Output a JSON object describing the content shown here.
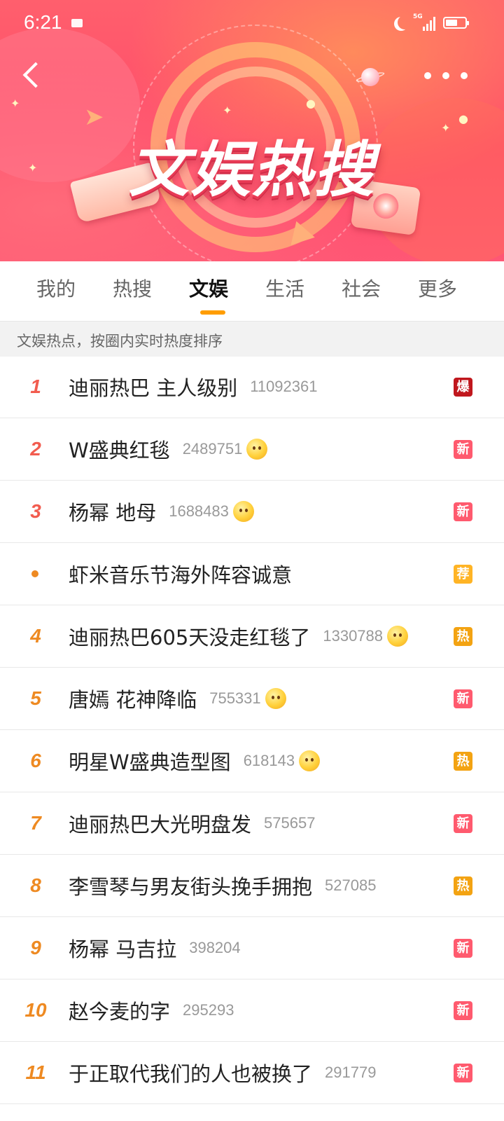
{
  "status_bar": {
    "time": "6:21",
    "network": "5G"
  },
  "header": {
    "title": "文娱热搜"
  },
  "tabs": [
    "我的",
    "热搜",
    "文娱",
    "生活",
    "社会",
    "更多"
  ],
  "active_tab": "文娱",
  "subtitle": "文娱热点，按圈内实时热度排序",
  "list": [
    {
      "rank": "1",
      "title": "迪丽热巴 主人级别",
      "count": "11092361",
      "emoji": "",
      "badge": "爆",
      "badge_color": "#c0171d"
    },
    {
      "rank": "2",
      "title": "W盛典红毯",
      "count": "2489751",
      "emoji": "party-emoji-icon",
      "badge": "新",
      "badge_color": "#ff5a6e"
    },
    {
      "rank": "3",
      "title": "杨幂 地母",
      "count": "1688483",
      "emoji": "crying-emoji-icon",
      "badge": "新",
      "badge_color": "#ff5a6e"
    },
    {
      "rank": "",
      "title": "虾米音乐节海外阵容诚意",
      "count": "",
      "emoji": "",
      "badge": "荐",
      "badge_color": "#ffb425"
    },
    {
      "rank": "4",
      "title": "迪丽热巴605天没走红毯了",
      "count": "1330788",
      "emoji": "hungry-emoji-icon",
      "badge": "热",
      "badge_color": "#f3a312"
    },
    {
      "rank": "5",
      "title": "唐嫣 花神降临",
      "count": "755331",
      "emoji": "love-emoji-icon",
      "badge": "新",
      "badge_color": "#ff5a6e"
    },
    {
      "rank": "6",
      "title": "明星W盛典造型图",
      "count": "618143",
      "emoji": "love-emoji-icon",
      "badge": "热",
      "badge_color": "#f3a312"
    },
    {
      "rank": "7",
      "title": "迪丽热巴大光明盘发",
      "count": "575657",
      "emoji": "",
      "badge": "新",
      "badge_color": "#ff5a6e"
    },
    {
      "rank": "8",
      "title": "李雪琴与男友街头挽手拥抱",
      "count": "527085",
      "emoji": "",
      "badge": "热",
      "badge_color": "#f3a312"
    },
    {
      "rank": "9",
      "title": "杨幂 马吉拉",
      "count": "398204",
      "emoji": "",
      "badge": "新",
      "badge_color": "#ff5a6e"
    },
    {
      "rank": "10",
      "title": "赵今麦的字",
      "count": "295293",
      "emoji": "",
      "badge": "新",
      "badge_color": "#ff5a6e"
    },
    {
      "rank": "11",
      "title": "于正取代我们的人也被换了",
      "count": "291779",
      "emoji": "",
      "badge": "新",
      "badge_color": "#ff5a6e"
    }
  ]
}
